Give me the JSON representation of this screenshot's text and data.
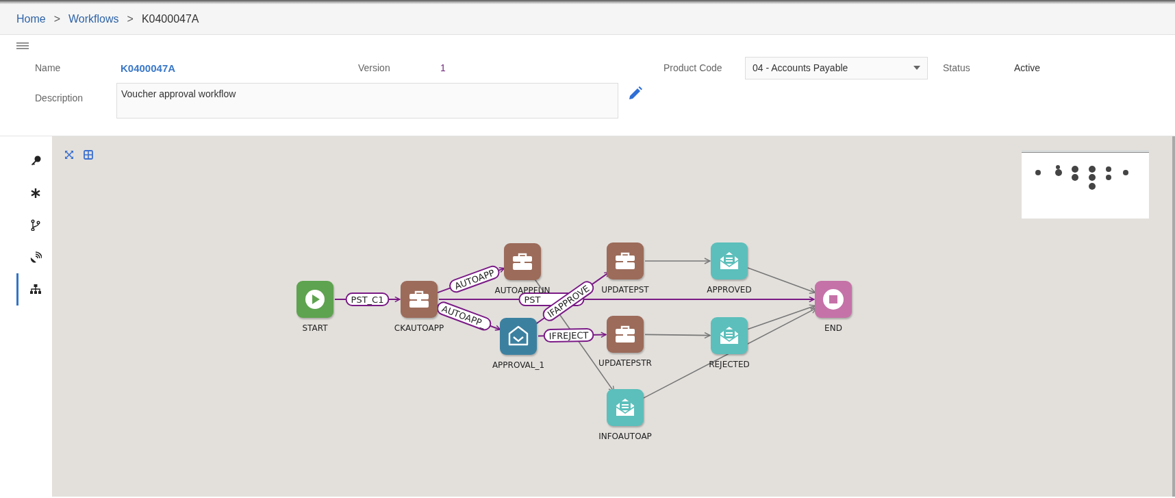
{
  "breadcrumb": [
    {
      "label": "Home",
      "kind": "link"
    },
    {
      "label": "Workflows",
      "kind": "link"
    },
    {
      "label": "K0400047A",
      "kind": "current"
    }
  ],
  "breadcrumb_separator": ">",
  "fields": {
    "name_label": "Name",
    "name": "K0400047A",
    "version_label": "Version",
    "version": "1",
    "product_code_label": "Product Code",
    "product_code": "04 - Accounts Payable",
    "status_label": "Status",
    "status": "Active",
    "description_label": "Description",
    "description": "Voucher approval workflow"
  },
  "sidebar": {
    "items": [
      {
        "selected": false
      },
      {
        "selected": false
      },
      {
        "selected": false
      },
      {
        "selected": false
      },
      {
        "selected": true
      }
    ]
  },
  "diagram": {
    "nodes": [
      {
        "label": "START",
        "kind": "start"
      },
      {
        "label": "CKAUTOAPP",
        "kind": "task"
      },
      {
        "label": "AUTOAPPFUN",
        "kind": "task"
      },
      {
        "label": "APPROVAL_1",
        "kind": "approval"
      },
      {
        "label": "UPDATEPST",
        "kind": "task"
      },
      {
        "label": "UPDATEPSTR",
        "kind": "task"
      },
      {
        "label": "INFOAUTOAP",
        "kind": "notification"
      },
      {
        "label": "APPROVED",
        "kind": "notification"
      },
      {
        "label": "REJECTED",
        "kind": "notification"
      },
      {
        "label": "END",
        "kind": "end"
      }
    ],
    "edges": [
      {
        "kind": "conditional",
        "label": "PST_C1"
      },
      {
        "kind": "conditional",
        "label": "AUTOAPP"
      },
      {
        "kind": "conditional",
        "label": "AUTOAPP_"
      },
      {
        "kind": "conditional",
        "label": "PST"
      },
      {
        "kind": "conditional",
        "label": "IFAPPROVE"
      },
      {
        "kind": "conditional",
        "label": "IFREJECT"
      },
      {
        "kind": "plain"
      },
      {
        "kind": "plain"
      },
      {
        "kind": "plain"
      },
      {
        "kind": "plain"
      },
      {
        "kind": "plain"
      },
      {
        "kind": "plain"
      }
    ]
  }
}
